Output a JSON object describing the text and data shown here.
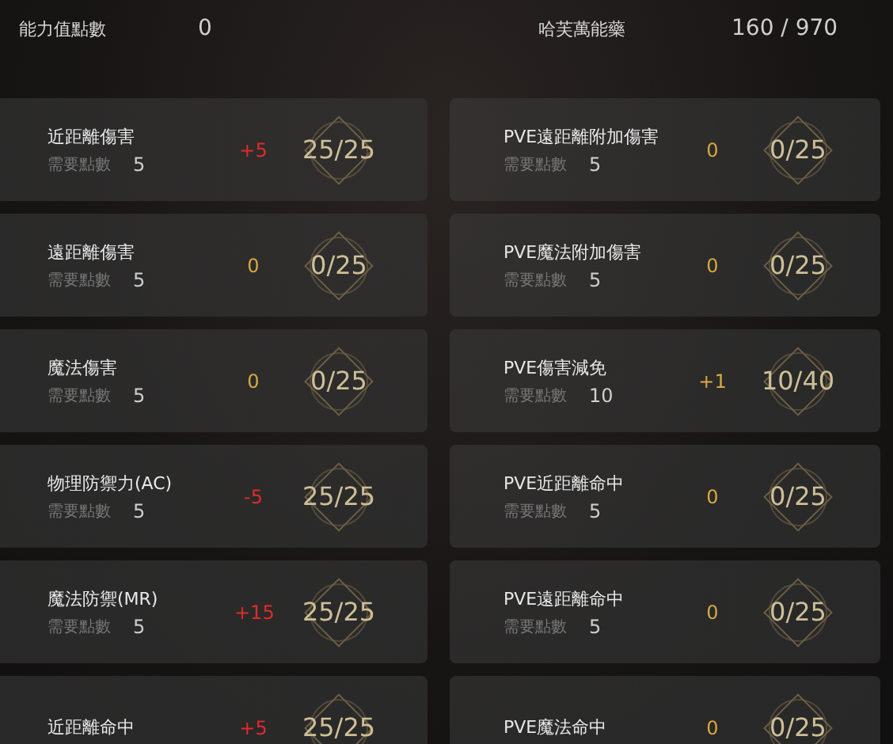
{
  "header": {
    "points_label": "能力值點數",
    "points_value": "0",
    "energy_label": "哈芙萬能藥",
    "energy_value": "160 / 970"
  },
  "columns": [
    {
      "stats": [
        {
          "name": "近距離傷害",
          "delta": "+5",
          "changed": true,
          "progress": "25/25",
          "cost_label": "需要點數",
          "cost": "5"
        },
        {
          "name": "遠距離傷害",
          "delta": "0",
          "changed": false,
          "progress": "0/25",
          "cost_label": "需要點數",
          "cost": "5"
        },
        {
          "name": "魔法傷害",
          "delta": "0",
          "changed": false,
          "progress": "0/25",
          "cost_label": "需要點數",
          "cost": "5"
        },
        {
          "name": "物理防禦力(AC)",
          "delta": "-5",
          "changed": true,
          "progress": "25/25",
          "cost_label": "需要點數",
          "cost": "5"
        },
        {
          "name": "魔法防禦(MR)",
          "delta": "+15",
          "changed": true,
          "progress": "25/25",
          "cost_label": "需要點數",
          "cost": "5"
        },
        {
          "name": "近距離命中",
          "delta": "+5",
          "changed": true,
          "progress": "25/25"
        }
      ]
    },
    {
      "stats": [
        {
          "name": "PVE遠距離附加傷害",
          "delta": "0",
          "changed": false,
          "progress": "0/25",
          "cost_label": "需要點數",
          "cost": "5"
        },
        {
          "name": "PVE魔法附加傷害",
          "delta": "0",
          "changed": false,
          "progress": "0/25",
          "cost_label": "需要點數",
          "cost": "5"
        },
        {
          "name": "PVE傷害減免",
          "delta": "+1",
          "changed": false,
          "progress": "10/40",
          "cost_label": "需要點數",
          "cost": "10"
        },
        {
          "name": "PVE近距離命中",
          "delta": "0",
          "changed": false,
          "progress": "0/25",
          "cost_label": "需要點數",
          "cost": "5"
        },
        {
          "name": "PVE遠距離命中",
          "delta": "0",
          "changed": false,
          "progress": "0/25",
          "cost_label": "需要點數",
          "cost": "5"
        },
        {
          "name": "PVE魔法命中",
          "delta": "0",
          "changed": false,
          "progress": "0/25"
        }
      ]
    }
  ]
}
